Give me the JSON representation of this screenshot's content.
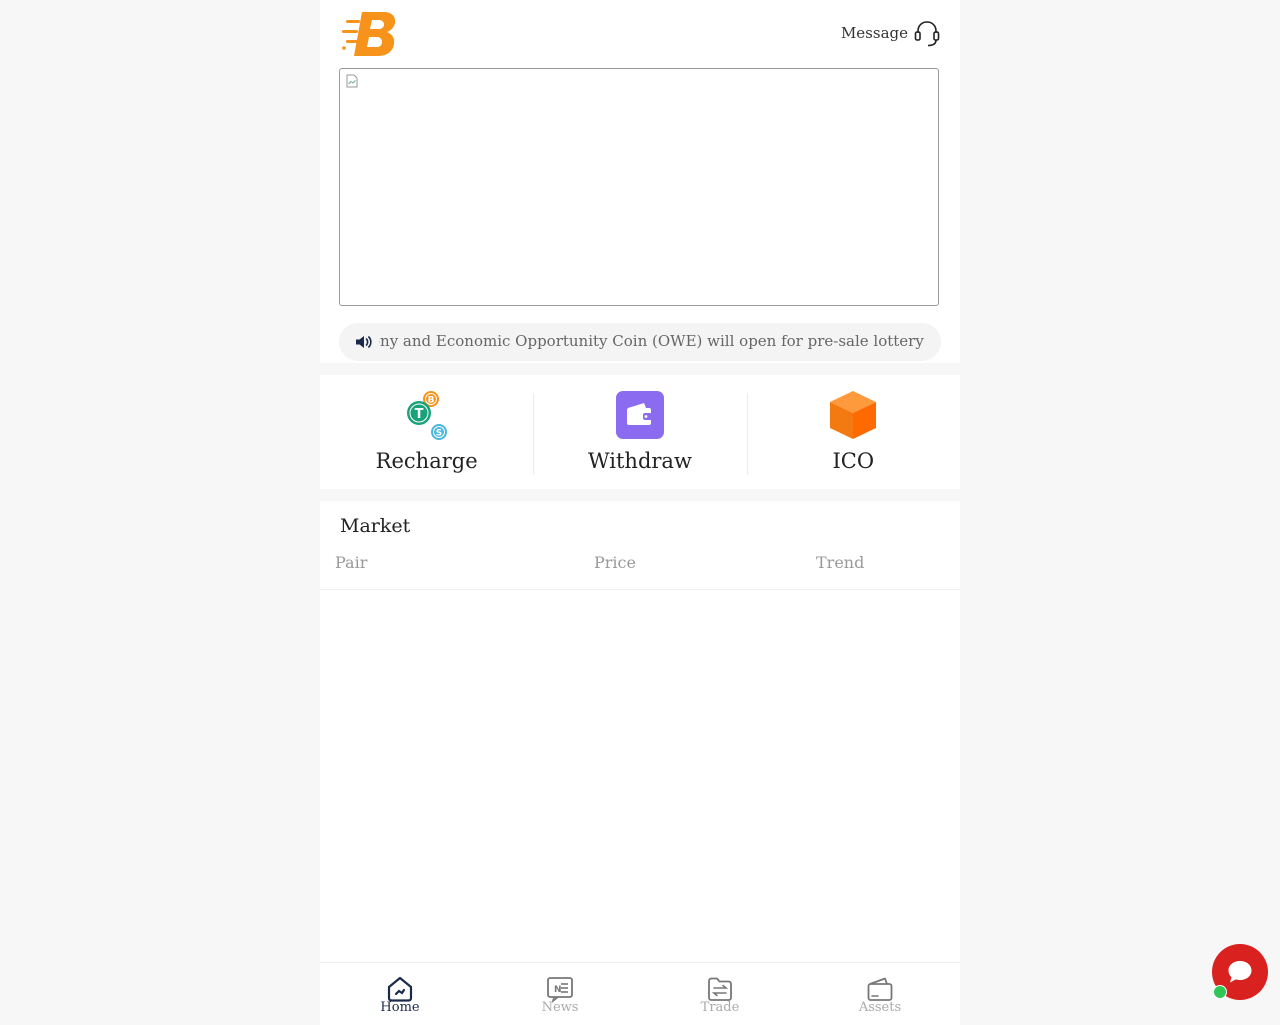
{
  "header": {
    "message_label": "Message",
    "brand_color": "#f7931a",
    "logo_icon": "brand-b-logo-icon",
    "support_icon": "headset-icon"
  },
  "banner": {
    "image_state": "broken-image-icon"
  },
  "notice": {
    "icon": "speaker-icon",
    "text": "ony and Economic Opportunity Coin (OWE) will open for pre-sale lottery on B"
  },
  "quick_actions": [
    {
      "label": "Recharge",
      "icon": "coins-icon"
    },
    {
      "label": "Withdraw",
      "icon": "wallet-icon"
    },
    {
      "label": "ICO",
      "icon": "cube-icon"
    }
  ],
  "market": {
    "title": "Market",
    "columns": [
      "Pair",
      "Price",
      "Trend"
    ],
    "rows": []
  },
  "tabbar": {
    "items": [
      {
        "label": "Home",
        "icon": "home-icon",
        "active": true
      },
      {
        "label": "News",
        "icon": "news-icon",
        "active": false
      },
      {
        "label": "Trade",
        "icon": "trade-icon",
        "active": false
      },
      {
        "label": "Assets",
        "icon": "wallet-icon",
        "active": false
      }
    ],
    "active_color": "#1b2a4a",
    "inactive_color": "#aaaaaa"
  },
  "chat": {
    "icon": "chat-bubble-icon",
    "color": "#d9211f",
    "status_color": "#2ec656"
  }
}
